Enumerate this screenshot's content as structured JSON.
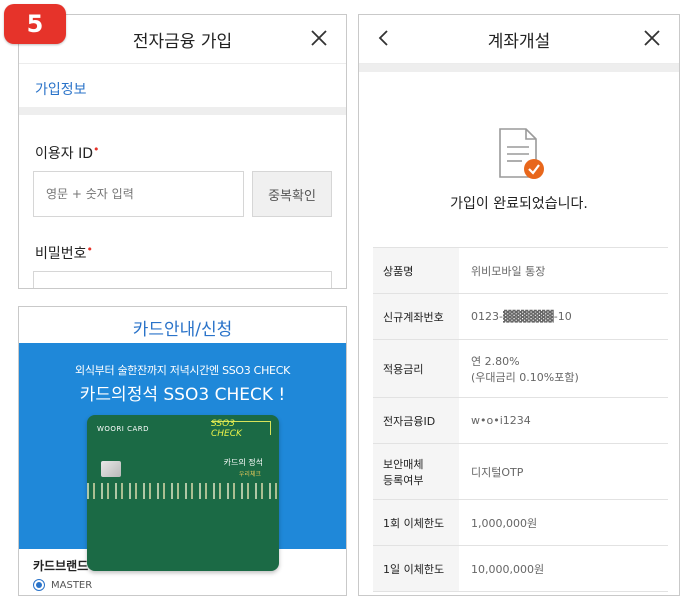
{
  "step_badge": "5",
  "signup_panel": {
    "title": "전자금융 가입",
    "section_link": "가입정보",
    "user_id_label": "이용자 ID",
    "user_id_placeholder": "영문 + 숫자 입력",
    "dup_check_button": "중복확인",
    "password_label": "비밀번호",
    "required_mark": "•"
  },
  "card_panel": {
    "title": "카드안내/신청",
    "promo_sub": "외식부터 술한잔까지 저녁시간엔 SSO3 CHECK",
    "promo_main": "카드의정석 SSO3 CHECK !",
    "card": {
      "brand": "WOORI CARD",
      "logo": "SSO3 CHECK",
      "name": "카드의 정석",
      "subname": "우리체크"
    },
    "brand_label": "카드브랜드",
    "brand_option": "MASTER"
  },
  "account_panel": {
    "title": "계좌개설",
    "complete_message": "가입이 완료되었습니다.",
    "rows": [
      {
        "key": "상품명",
        "value": "위비모바일 통장"
      },
      {
        "key": "신규계좌번호",
        "value": "0123-▓▓▓▓▓▓-10"
      },
      {
        "key": "적용금리",
        "value": "연 2.80%",
        "value2": "(우대금리 0.10%포함)"
      },
      {
        "key": "전자금융ID",
        "value": "w•o•i1234"
      },
      {
        "key": "보안매체",
        "key2": "등록여부",
        "value": "디지털OTP"
      },
      {
        "key": "1회 이체한도",
        "value": "1,000,000원"
      },
      {
        "key": "1일 이체한도",
        "value": "10,000,000원"
      }
    ]
  },
  "colors": {
    "accent_blue": "#2a73c9",
    "promo_blue": "#1f88d9",
    "badge_red": "#e6332a",
    "rate_orange": "#e8671c",
    "card_green": "#1b6a45"
  }
}
